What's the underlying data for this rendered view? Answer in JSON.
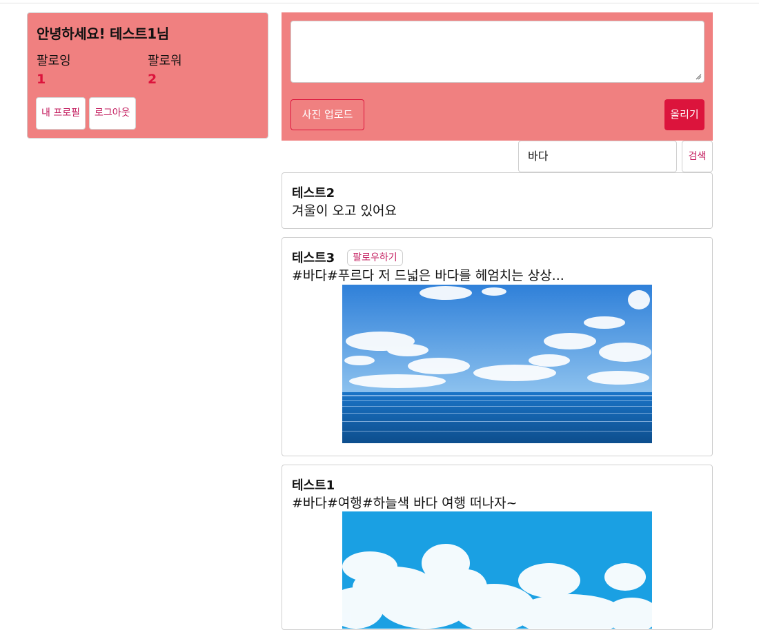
{
  "profile": {
    "greeting": "안녕하세요! 테스트1님",
    "following_label": "팔로잉",
    "following_count": "1",
    "follower_label": "팔로워",
    "follower_count": "2",
    "my_profile_button": "내 프로필",
    "logout_button": "로그아웃"
  },
  "post_form": {
    "textarea_value": "",
    "upload_button": "사진 업로드",
    "submit_button": "올리기"
  },
  "search": {
    "value": "바다",
    "button": "검색"
  },
  "posts": [
    {
      "author": "테스트2",
      "content": "겨울이 오고 있어요"
    },
    {
      "author": "테스트3",
      "follow_button": "팔로우하기",
      "content": "#바다#푸르다 저 드넓은 바다를 헤엄치는 상상..."
    },
    {
      "author": "테스트1",
      "content": "#바다#여행#하늘색 바다 여행 떠나자~"
    }
  ],
  "colors": {
    "panel": "#f08080",
    "accent": "#dc143c",
    "link": "#c2185b"
  }
}
